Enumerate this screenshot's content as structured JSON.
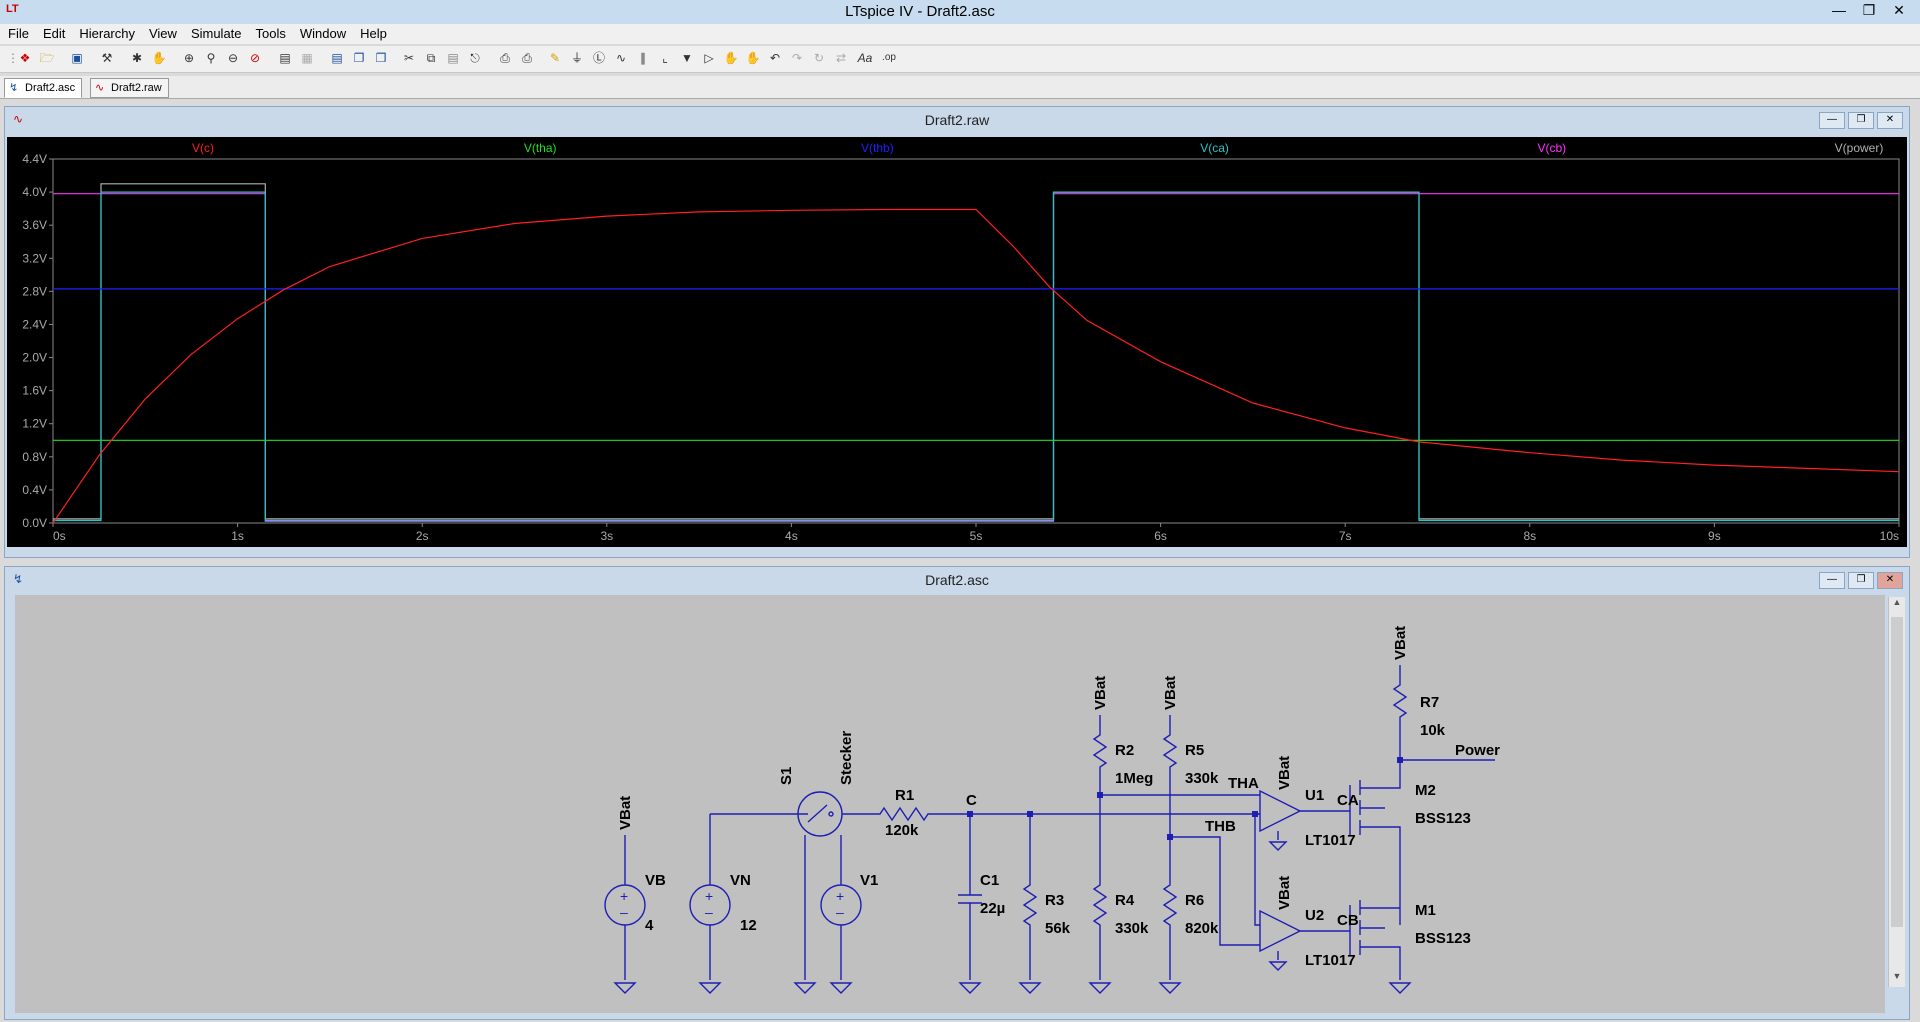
{
  "window": {
    "title": "LTspice IV - Draft2.asc",
    "app_icon": "LT"
  },
  "menu": [
    "File",
    "Edit",
    "Hierarchy",
    "View",
    "Simulate",
    "Tools",
    "Window",
    "Help"
  ],
  "tabs": [
    {
      "label": "Draft2.asc",
      "icon": "schematic-icon"
    },
    {
      "label": "Draft2.raw",
      "icon": "waveform-icon"
    }
  ],
  "plot_window": {
    "title": "Draft2.raw"
  },
  "schematic_window": {
    "title": "Draft2.asc"
  },
  "chart_data": {
    "type": "line",
    "background": "#000000",
    "xlabel": "",
    "ylabel": "",
    "x_ticks": [
      "0s",
      "1s",
      "2s",
      "3s",
      "4s",
      "5s",
      "6s",
      "7s",
      "8s",
      "9s",
      "10s"
    ],
    "y_ticks": [
      "0.0V",
      "0.4V",
      "0.8V",
      "1.2V",
      "1.6V",
      "2.0V",
      "2.4V",
      "2.8V",
      "3.2V",
      "3.6V",
      "4.0V",
      "4.4V"
    ],
    "xlim": [
      0,
      10
    ],
    "ylim": [
      0,
      4.4
    ],
    "series": [
      {
        "name": "V(c)",
        "color": "#ff2020",
        "x": [
          0,
          0.25,
          0.5,
          0.75,
          1,
          1.25,
          1.5,
          2,
          2.5,
          3,
          3.5,
          4,
          4.5,
          5,
          5.2,
          5.4,
          5.6,
          6,
          6.5,
          7,
          7.4,
          8,
          8.5,
          9,
          9.5,
          10
        ],
        "y": [
          0,
          0.82,
          1.5,
          2.04,
          2.47,
          2.82,
          3.1,
          3.44,
          3.62,
          3.71,
          3.76,
          3.78,
          3.79,
          3.79,
          3.35,
          2.85,
          2.45,
          1.95,
          1.45,
          1.15,
          0.98,
          0.85,
          0.76,
          0.7,
          0.66,
          0.62
        ]
      },
      {
        "name": "V(tha)",
        "color": "#20e020",
        "x": [
          0,
          10
        ],
        "y": [
          1.0,
          1.0
        ]
      },
      {
        "name": "V(thb)",
        "color": "#2020ff",
        "x": [
          0,
          10
        ],
        "y": [
          2.83,
          2.83
        ]
      },
      {
        "name": "V(ca)",
        "color": "#20c8c8",
        "x": [
          0,
          0.26,
          0.26,
          1.15,
          1.15,
          5.42,
          5.42,
          7.4,
          7.4,
          10
        ],
        "y": [
          0.03,
          0.03,
          4.0,
          4.0,
          0.03,
          0.03,
          4.0,
          4.0,
          0.03,
          0.03
        ]
      },
      {
        "name": "V(cb)",
        "color": "#ff30ff",
        "x": [
          0,
          0.26,
          0.26,
          1.15,
          1.15,
          5.42,
          5.42,
          7.4,
          7.4,
          10
        ],
        "y": [
          3.98,
          3.98,
          3.98,
          3.98,
          0.02,
          0.02,
          3.98,
          3.98,
          3.98,
          3.98
        ]
      },
      {
        "name": "V(power)",
        "color": "#b0b0b0",
        "x": [
          0,
          0.26,
          0.26,
          1.15,
          1.15,
          5.42,
          5.42,
          7.4,
          7.4,
          10
        ],
        "y": [
          0.05,
          0.05,
          4.1,
          4.1,
          0.05,
          0.05,
          4.0,
          4.0,
          0.05,
          0.05
        ]
      }
    ]
  },
  "schematic": {
    "wire_color": "#1e1eb4",
    "labels": {
      "vbat": "VBat",
      "stecker": "Stecker",
      "s1": "S1",
      "c": "C",
      "tha": "THA",
      "thb": "THB",
      "ca": "CA",
      "cb": "CB",
      "power": "Power"
    },
    "components": [
      {
        "name": "VB",
        "value": "4"
      },
      {
        "name": "VN",
        "value": "12"
      },
      {
        "name": "V1",
        "value": ""
      },
      {
        "name": "R1",
        "value": "120k"
      },
      {
        "name": "C1",
        "value": "22µ"
      },
      {
        "name": "R3",
        "value": "56k"
      },
      {
        "name": "R2",
        "value": "1Meg"
      },
      {
        "name": "R4",
        "value": "330k"
      },
      {
        "name": "R5",
        "value": "330k"
      },
      {
        "name": "R6",
        "value": "820k"
      },
      {
        "name": "U1",
        "value": "LT1017"
      },
      {
        "name": "U2",
        "value": "LT1017"
      },
      {
        "name": "R7",
        "value": "10k"
      },
      {
        "name": "M2",
        "value": "BSS123"
      },
      {
        "name": "M1",
        "value": "BSS123"
      }
    ]
  }
}
